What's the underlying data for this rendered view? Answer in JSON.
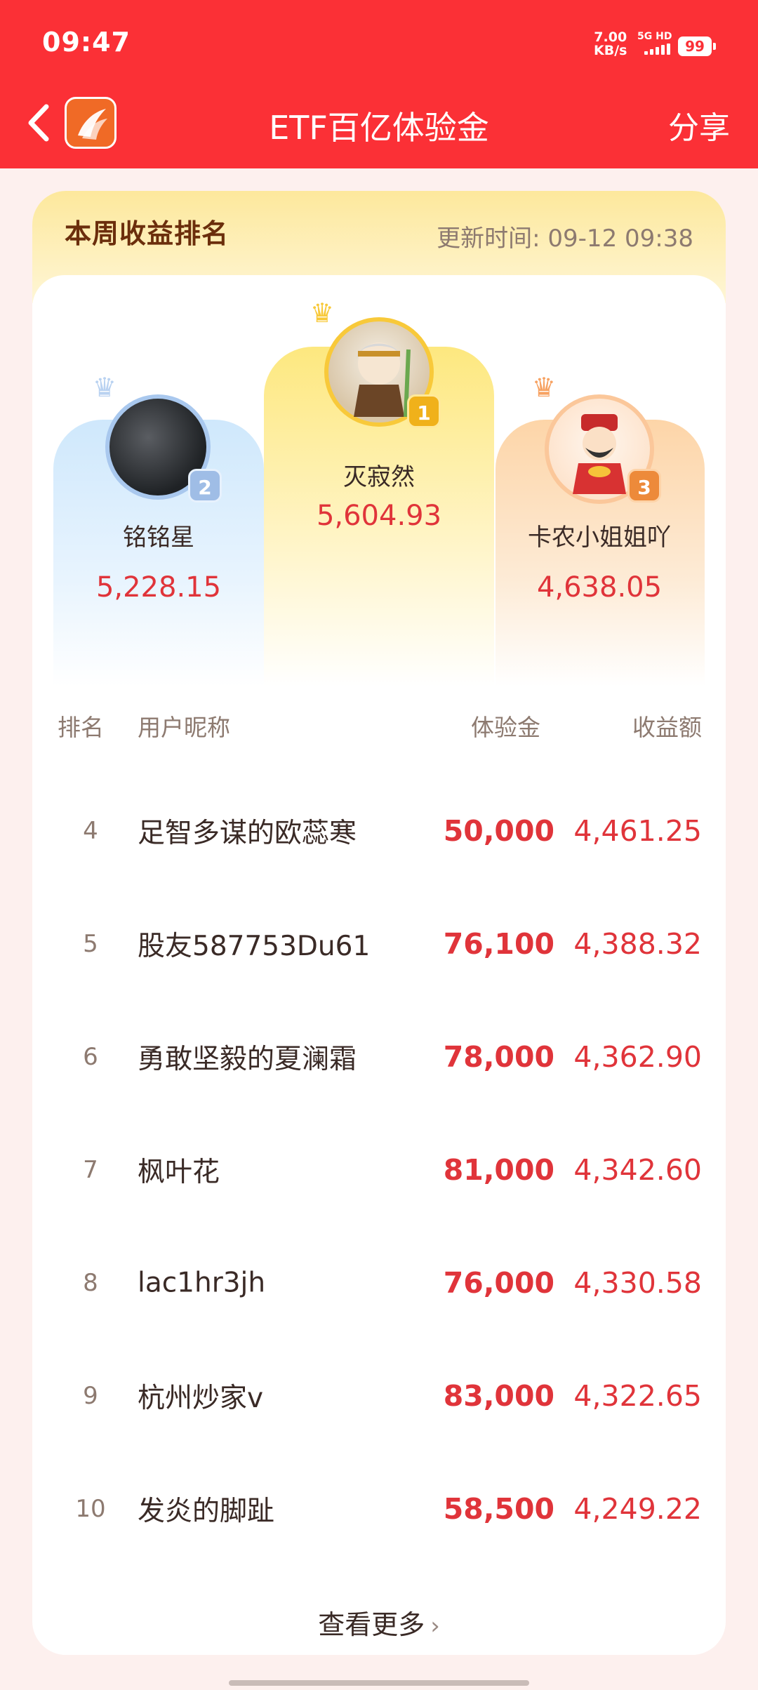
{
  "status_bar": {
    "time": "09:47",
    "net_speed": "7.00",
    "net_unit": "KB/s",
    "signal": "5G HD",
    "battery": "99"
  },
  "header": {
    "title": "ETF百亿体验金",
    "share_label": "分享",
    "back_icon": "chevron-left-icon",
    "logo_icon": "app-logo-icon"
  },
  "ranking": {
    "title": "本周收益排名",
    "update_time": "更新时间: 09-12 09:38",
    "podium": [
      {
        "rank": "1",
        "name": "灭寂然",
        "score": "5,604.93"
      },
      {
        "rank": "2",
        "name": "铭铭星",
        "score": "5,228.15"
      },
      {
        "rank": "3",
        "name": "卡农小姐姐吖",
        "score": "4,638.05"
      }
    ],
    "columns": {
      "rank": "排名",
      "nickname": "用户昵称",
      "amount": "体验金",
      "profit": "收益额"
    },
    "rows": [
      {
        "rank": "4",
        "name": "足智多谋的欧蕊寒",
        "amount": "50,000",
        "profit": "4,461.25"
      },
      {
        "rank": "5",
        "name": "股友587753Du61",
        "amount": "76,100",
        "profit": "4,388.32"
      },
      {
        "rank": "6",
        "name": "勇敢坚毅的夏澜霜",
        "amount": "78,000",
        "profit": "4,362.90"
      },
      {
        "rank": "7",
        "name": "枫叶花",
        "amount": "81,000",
        "profit": "4,342.60"
      },
      {
        "rank": "8",
        "name": "lac1hr3jh",
        "amount": "76,000",
        "profit": "4,330.58"
      },
      {
        "rank": "9",
        "name": "杭州炒家v",
        "amount": "83,000",
        "profit": "4,322.65"
      },
      {
        "rank": "10",
        "name": "发炎的脚趾",
        "amount": "58,500",
        "profit": "4,249.22"
      }
    ],
    "more_label": "查看更多"
  },
  "colors": {
    "brand_red": "#fb3036",
    "value_red": "#e0343a",
    "gold": "#f8c93a"
  }
}
